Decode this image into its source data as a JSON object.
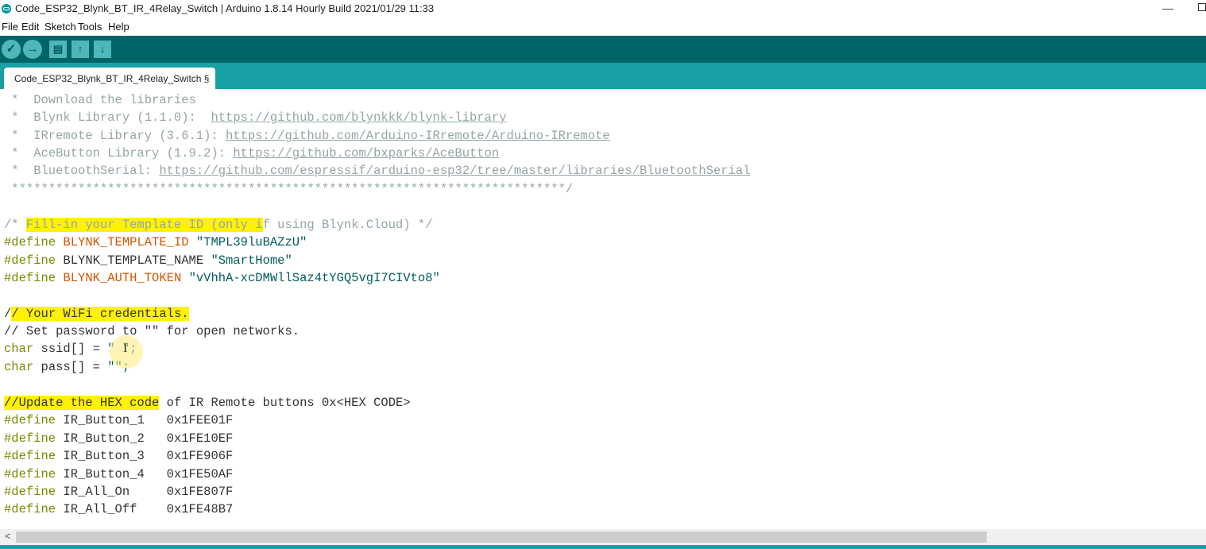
{
  "window": {
    "title": "Code_ESP32_Blynk_BT_IR_4Relay_Switch | Arduino 1.8.14 Hourly Build 2021/01/29 11:33"
  },
  "menu": [
    "File",
    "Edit",
    "Sketch",
    "Tools",
    "Help"
  ],
  "toolbar": {
    "verify": "✓",
    "upload": "→",
    "new": "▤",
    "open": "↑",
    "save": "↓"
  },
  "tab": {
    "label": "Code_ESP32_Blynk_BT_IR_4Relay_Switch §"
  },
  "code": {
    "l1": {
      "text": " *  Download the libraries"
    },
    "l2": {
      "prefix": " *  Blynk Library (1.1.0):  ",
      "link": "https://github.com/blynkkk/blynk-library"
    },
    "l3": {
      "prefix": " *  IRremote Library (3.6.1): ",
      "link": "https://github.com/Arduino-IRremote/Arduino-IRremote"
    },
    "l4": {
      "prefix": " *  AceButton Library (1.9.2): ",
      "link": "https://github.com/bxparks/AceButton"
    },
    "l5": {
      "prefix": " *  BluetoothSerial: ",
      "link": "https://github.com/espressif/arduino-esp32/tree/master/libraries/BluetoothSerial"
    },
    "l6": {
      "text": " ***************************************************************************/"
    },
    "l7": {
      "a": "/* ",
      "b": "Fill-in your Template ID (only i",
      "c": "f using Blynk.Cloud) */"
    },
    "l8": {
      "kw": "#define",
      "name": " BLYNK_TEMPLATE_ID",
      "val": " \"TMPL39luBAZzU\""
    },
    "l9": {
      "kw": "#define",
      "name": " BLYNK_TEMPLATE_NAME",
      "val": " \"SmartHome\""
    },
    "l10": {
      "kw": "#define",
      "name": " BLYNK_AUTH_TOKEN",
      "val": " \"vVhhA-xcDMWllSaz4tYGQ5vgI7CIVto8\""
    },
    "l11": {
      "a": "/",
      "b": "/ Your WiFi credentials."
    },
    "l12": {
      "text": "// Set password to \"\" for open networks."
    },
    "l13": {
      "kw": "char",
      "rest": " ssid[] = ",
      "val": "\" \";"
    },
    "l14": {
      "kw": "char",
      "rest": " pass[] = ",
      "val": "\"\";"
    },
    "l15": {
      "a": "//Update the HEX code",
      "b": " of IR Remote buttons 0x<HEX CODE>"
    },
    "l16": {
      "kw": "#define",
      "rest": " IR_Button_1   0x1FEE01F"
    },
    "l17": {
      "kw": "#define",
      "rest": " IR_Button_2   0x1FE10EF"
    },
    "l18": {
      "kw": "#define",
      "rest": " IR_Button_3   0x1FE906F"
    },
    "l19": {
      "kw": "#define",
      "rest": " IR_Button_4   0x1FE50AF"
    },
    "l20": {
      "kw": "#define",
      "rest": " IR_All_On     0x1FE807F"
    },
    "l21": {
      "kw": "#define",
      "rest": " IR_All_Off    0x1FE48B7"
    }
  },
  "cursor_glyph": "I",
  "scroll_left": "<",
  "window_controls": {
    "minimize": "—"
  },
  "colors": {
    "toolbar": "#006468",
    "tabbar": "#17a1a5",
    "keyword": "#728e00",
    "highlight": "#fff200"
  }
}
